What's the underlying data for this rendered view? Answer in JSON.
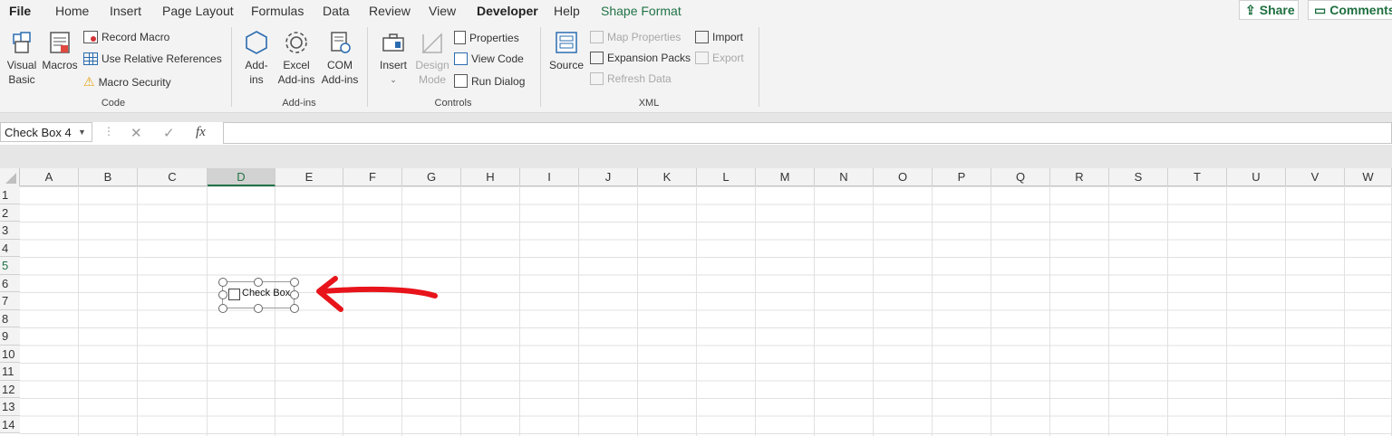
{
  "ribbon_tabs": {
    "file": "File",
    "home": "Home",
    "insert": "Insert",
    "page_layout": "Page Layout",
    "formulas": "Formulas",
    "data": "Data",
    "review": "Review",
    "view": "View",
    "developer": "Developer",
    "help": "Help",
    "shape_format": "Shape Format"
  },
  "top_right": {
    "share": "Share",
    "comments": "Comments"
  },
  "groups": {
    "code": {
      "label": "Code",
      "visual_basic": "Visual\nBasic",
      "macros": "Macros",
      "record_macro": "Record Macro",
      "relative_refs": "Use Relative References",
      "macro_security": "Macro Security"
    },
    "addins": {
      "label": "Add-ins",
      "addins_btn": "Add-\nins",
      "excel_addins": "Excel\nAdd-ins",
      "com_addins": "COM\nAdd-ins"
    },
    "controls": {
      "label": "Controls",
      "insert": "Insert",
      "design_mode": "Design\nMode",
      "properties": "Properties",
      "view_code": "View Code",
      "run_dialog": "Run Dialog"
    },
    "xml": {
      "label": "XML",
      "source": "Source",
      "map_properties": "Map Properties",
      "expansion_packs": "Expansion Packs",
      "refresh_data": "Refresh Data",
      "import": "Import",
      "export": "Export"
    }
  },
  "formula_bar": {
    "name_box": "Check Box 4",
    "formula": ""
  },
  "columns": [
    "A",
    "B",
    "C",
    "D",
    "E",
    "F",
    "G",
    "H",
    "I",
    "J",
    "K",
    "L",
    "M",
    "N",
    "O",
    "P",
    "Q",
    "R",
    "S",
    "T",
    "U",
    "V",
    "W"
  ],
  "selected_column": "D",
  "rows": [
    "1",
    "2",
    "3",
    "4",
    "5",
    "6",
    "7",
    "8",
    "9",
    "10",
    "11",
    "12",
    "13",
    "14"
  ],
  "selected_row": "5",
  "checkbox_control": {
    "label": "Check Box"
  },
  "colors": {
    "accent": "#217346",
    "annotation_arrow": "#e8141b"
  }
}
